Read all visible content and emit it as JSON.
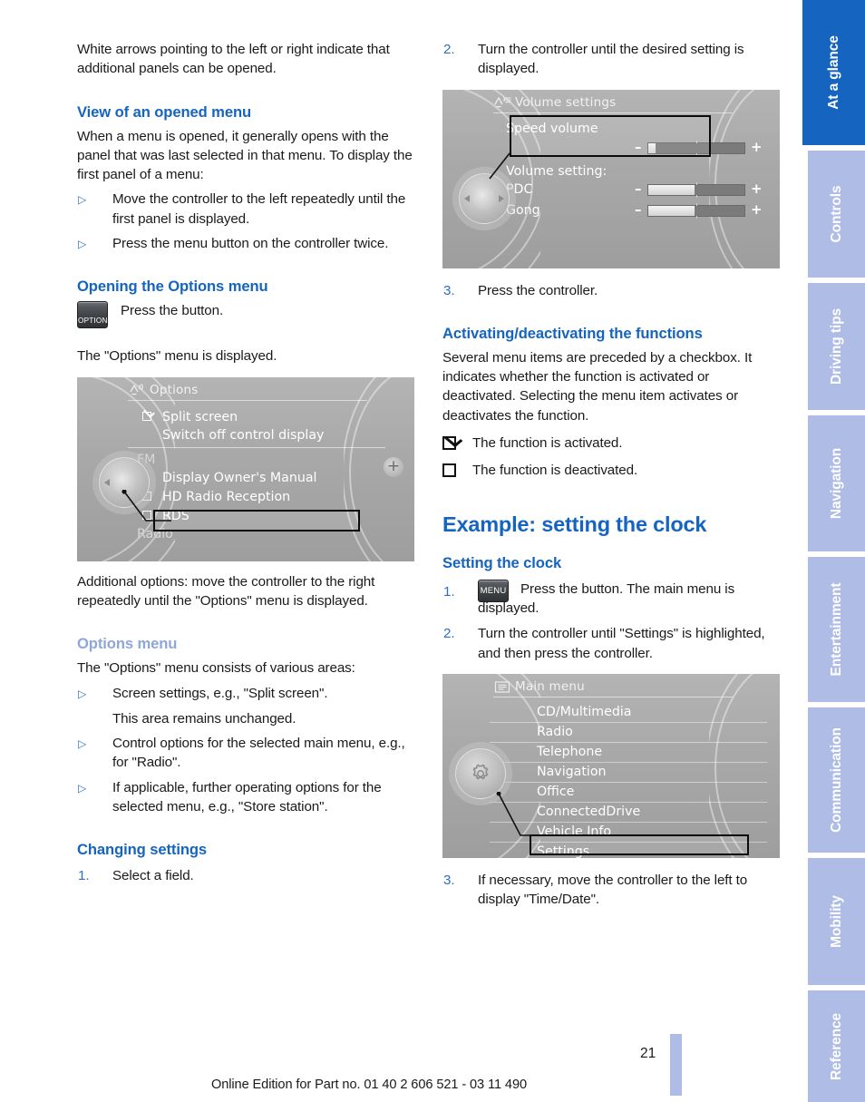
{
  "left_column": {
    "intro_paragraph": "White arrows pointing to the left or right indicate that additional panels can be opened.",
    "heading_view": "View of an opened menu",
    "view_paragraph": "When a menu is opened, it generally opens with the panel that was last selected in that menu. To display the first panel of a menu:",
    "view_bullets": [
      "Move the controller to the left repeatedly until the first panel is displayed.",
      "Press the menu button on the controller twice."
    ],
    "heading_opening": "Opening the Options menu",
    "option_button_label": "OPTION",
    "option_button_text": "Press the button.",
    "options_displayed": "The \"Options\" menu is displayed.",
    "options_panel": {
      "title": "Options",
      "header_icon": "signal-antenna-icon",
      "rows": [
        {
          "label": "Split screen",
          "checkbox": "checked"
        },
        {
          "label": "Switch off control display",
          "checkbox": "none"
        },
        {
          "label": "FM",
          "checkbox": "none",
          "dim": true
        },
        {
          "label": "Display Owner's Manual",
          "checkbox": "none"
        },
        {
          "label": "HD Radio Reception",
          "checkbox": "unchecked"
        },
        {
          "label": "RDS",
          "checkbox": "unchecked",
          "selected": true
        },
        {
          "label": "Radio",
          "checkbox": "none",
          "dim": true
        }
      ],
      "plus_badge": "+"
    },
    "additional_options_paragraph": "Additional options: move the controller to the right repeatedly until the \"Options\" menu is displayed.",
    "heading_options_menu": "Options menu",
    "options_menu_intro": "The \"Options\" menu consists of various areas:",
    "options_menu_bullets": [
      "Screen settings, e.g., \"Split screen\".",
      "Control options for the selected main menu, e.g., for \"Radio\".",
      "If applicable, further operating options for the selected menu, e.g., \"Store station\"."
    ],
    "options_menu_sub_note": "This area remains unchanged.",
    "heading_changing": "Changing settings",
    "changing_step_1_num": "1.",
    "changing_step_1": "Select a field."
  },
  "right_column": {
    "step_2_num": "2.",
    "step_2_text": "Turn the controller until the desired setting is displayed.",
    "volume_panel": {
      "title": "Volume settings",
      "header_icon": "signal-antenna-list-icon",
      "selected_label": "Speed volume",
      "section_label": "Volume setting:",
      "rows": [
        {
          "label": "Speed volume",
          "minus": "–",
          "plus": "+",
          "fill_percent": 6,
          "selected": true
        },
        {
          "label": "PDC",
          "minus": "–",
          "plus": "+",
          "fill_percent": 48
        },
        {
          "label": "Gong",
          "minus": "–",
          "plus": "+",
          "fill_percent": 48
        }
      ]
    },
    "step_3_num": "3.",
    "step_3_text": "Press the controller.",
    "heading_activating": "Activating/deactivating the functions",
    "activating_paragraph": "Several menu items are preceded by a checkbox. It indicates whether the function is activated or deactivated. Selecting the menu item activates or deactivates the function.",
    "legend_activated": "The function is activated.",
    "legend_deactivated": "The function is deactivated.",
    "heading_example": "Example: setting the clock",
    "heading_setting_clock": "Setting the clock",
    "clock_step_1_num": "1.",
    "menu_button_label": "MENU",
    "clock_step_1_text": "Press the button. The main menu is",
    "clock_step_1_text_cont": "displayed.",
    "clock_step_2_num": "2.",
    "clock_step_2_text": "Turn the controller until \"Settings\" is highlighted, and then press the controller.",
    "main_menu_panel": {
      "title": "Main menu",
      "header_icon": "list-lines-icon",
      "knob_icon": "gear-icon",
      "items": [
        "CD/Multimedia",
        "Radio",
        "Telephone",
        "Navigation",
        "Office",
        "ConnectedDrive",
        "Vehicle Info",
        "Settings"
      ],
      "selected_item": "Settings"
    },
    "clock_step_3_num": "3.",
    "clock_step_3_text": "If necessary, move the controller to the left to display \"Time/Date\"."
  },
  "sidebar": {
    "tabs": [
      {
        "label": "At a glance",
        "active": true
      },
      {
        "label": "Controls",
        "active": false
      },
      {
        "label": "Driving tips",
        "active": false
      },
      {
        "label": "Navigation",
        "active": false
      },
      {
        "label": "Entertainment",
        "active": false
      },
      {
        "label": "Communication",
        "active": false
      },
      {
        "label": "Mobility",
        "active": false
      },
      {
        "label": "Reference",
        "active": false
      }
    ]
  },
  "footer": {
    "edition_text": "Online Edition for Part no. 01 40 2 606 521 - 03 11 490",
    "page_number": "21"
  },
  "colors": {
    "heading_blue": "#1565c0",
    "muted_blue": "#8ea7da",
    "tab_inactive": "#aebce6",
    "tab_active": "#1565c0"
  }
}
